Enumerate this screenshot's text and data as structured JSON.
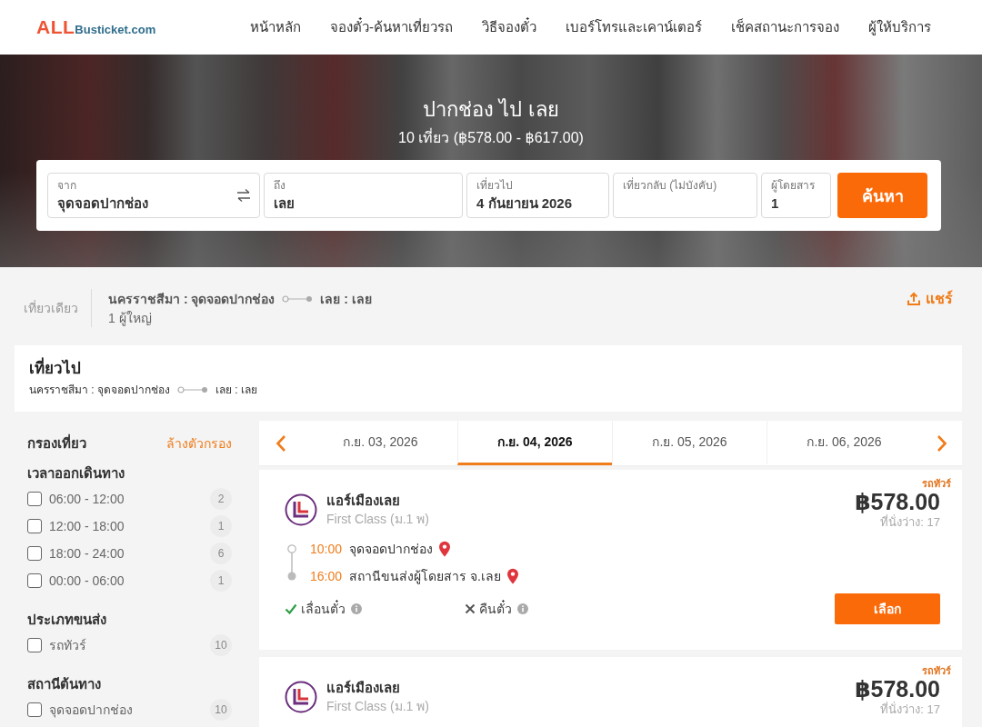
{
  "header": {
    "logo": {
      "prefix": "ALL",
      "suffix": "Busticket.com"
    },
    "nav": [
      "หน้าหลัก",
      "จองตั๋ว-ค้นหาเที่ยวรถ",
      "วิธีจองตั๋ว",
      "เบอร์โทรและเคาน์เตอร์",
      "เช็คสถานะการจอง",
      "ผู้ให้บริการ"
    ]
  },
  "hero": {
    "title": "ปากช่อง ไป เลย",
    "subtitle": "10 เที่ยว (฿578.00 - ฿617.00)"
  },
  "search": {
    "fields": [
      {
        "label": "จาก",
        "value": "จุดจอดปากช่อง"
      },
      {
        "label": "ถึง",
        "value": "เลย"
      },
      {
        "label": "เที่ยวไป",
        "value": "4 กันยายน 2026"
      },
      {
        "label": "เที่ยวกลับ (ไม่บังคับ)"
      },
      {
        "label": "ผู้โดยสาร",
        "value": "1"
      }
    ],
    "button": "ค้นหา"
  },
  "summary": {
    "trip_type": "เที่ยวเดียว",
    "origin": "นครราชสีมา : จุดจอดปากช่อง",
    "destination": "เลย : เลย",
    "passengers": "1 ผู้ใหญ่",
    "share": "แชร์"
  },
  "outbound": {
    "title": "เที่ยวไป",
    "origin": "นครราชสีมา : จุดจอดปากช่อง",
    "destination": "เลย : เลย"
  },
  "filters": {
    "title": "กรองเที่ยว",
    "clear": "ล้างตัวกรอง",
    "groups": [
      {
        "title": "เวลาออกเดินทาง",
        "options": [
          {
            "label": "06:00 - 12:00",
            "count": "2",
            "checked": false
          },
          {
            "label": "12:00 - 18:00",
            "count": "1",
            "checked": false
          },
          {
            "label": "18:00 - 24:00",
            "count": "6",
            "checked": false
          },
          {
            "label": "00:00 - 06:00",
            "count": "1",
            "checked": false
          }
        ]
      },
      {
        "title": "ประเภทขนส่ง",
        "options": [
          {
            "label": "รถทัวร์",
            "count": "10",
            "checked": false
          }
        ]
      },
      {
        "title": "สถานีต้นทาง",
        "options": [
          {
            "label": "จุดจอดปากช่อง",
            "count": "10",
            "checked": false
          }
        ]
      }
    ]
  },
  "date_tabs": [
    {
      "label": "ก.ย. 03, 2026",
      "selected": false
    },
    {
      "label": "ก.ย. 04, 2026",
      "selected": true
    },
    {
      "label": "ก.ย. 05, 2026",
      "selected": false
    },
    {
      "label": "ก.ย. 06, 2026",
      "selected": false
    }
  ],
  "trips": [
    {
      "tag": "รถทัวร์",
      "operator": "แอร์เมืองเลย",
      "class": "First Class (ม.1 พ)",
      "price": "฿578.00",
      "seats": "ที่นั่งว่าง: 17",
      "stops": [
        {
          "kind": "departure",
          "time": "10:00",
          "place": "จุดจอดปากช่อง"
        },
        {
          "kind": "arrival",
          "time": "16:00",
          "place": "สถานีขนส่งผู้โดยสาร จ.เลย"
        }
      ],
      "policies": [
        {
          "label": "เลื่อนตั๋ว",
          "allowed": true
        },
        {
          "label": "คืนตั๋ว",
          "allowed": false
        }
      ],
      "button": "เลือก"
    },
    {
      "tag": "รถทัวร์",
      "operator": "แอร์เมืองเลย",
      "class": "First Class (ม.1 พ)",
      "price": "฿578.00",
      "seats": "ที่นั่งว่าง: 17"
    }
  ]
}
